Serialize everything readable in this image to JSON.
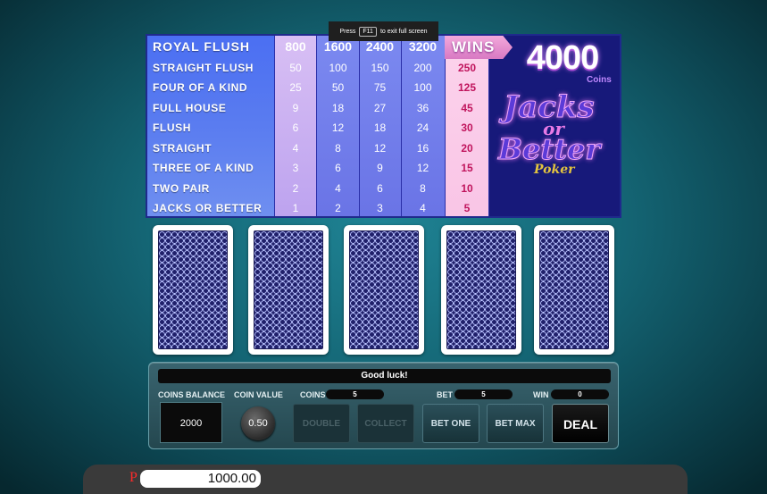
{
  "hint": {
    "prefix": "Press",
    "key": "F11",
    "suffix": "to exit full screen"
  },
  "paytable": {
    "bets": [
      "800",
      "1600",
      "2400",
      "3200"
    ],
    "rows": [
      {
        "name": "ROYAL FLUSH",
        "v": [
          "800",
          "1600",
          "2400",
          "3200"
        ],
        "win": ""
      },
      {
        "name": "STRAIGHT FLUSH",
        "v": [
          "50",
          "100",
          "150",
          "200"
        ],
        "win": "250"
      },
      {
        "name": "FOUR OF A KIND",
        "v": [
          "25",
          "50",
          "75",
          "100"
        ],
        "win": "125"
      },
      {
        "name": "FULL HOUSE",
        "v": [
          "9",
          "18",
          "27",
          "36"
        ],
        "win": "45"
      },
      {
        "name": "FLUSH",
        "v": [
          "6",
          "12",
          "18",
          "24"
        ],
        "win": "30"
      },
      {
        "name": "STRAIGHT",
        "v": [
          "4",
          "8",
          "12",
          "16"
        ],
        "win": "20"
      },
      {
        "name": "THREE OF A KIND",
        "v": [
          "3",
          "6",
          "9",
          "12"
        ],
        "win": "15"
      },
      {
        "name": "TWO PAIR",
        "v": [
          "2",
          "4",
          "6",
          "8"
        ],
        "win": "10"
      },
      {
        "name": "JACKS OR BETTER",
        "v": [
          "1",
          "2",
          "3",
          "4"
        ],
        "win": "5"
      }
    ],
    "wins_label": "WINS",
    "wins_amount": "4000",
    "coins_label": "Coins"
  },
  "logo": {
    "line1": "Jacks",
    "line2": "or",
    "line3": "Better",
    "line4": "Poker"
  },
  "cards": [
    "card-back",
    "card-back",
    "card-back",
    "card-back",
    "card-back"
  ],
  "panel": {
    "message": "Good luck!",
    "coins_balance_label": "COINS BALANCE",
    "coins_balance": "2000",
    "coin_value_label": "COIN VALUE",
    "coin_value": "0.50",
    "coins_label": "COINS",
    "coins": "5",
    "bet_label": "BET",
    "bet": "5",
    "win_label": "WIN",
    "win": "0",
    "btn_double": "DOUBLE",
    "btn_collect": "COLLECT",
    "btn_bet_one": "BET ONE",
    "btn_bet_max": "BET MAX",
    "btn_deal": "DEAL"
  },
  "bottom": {
    "currency_symbol": "P",
    "balance": "1000.00"
  },
  "colors": {
    "accent": "#1f8394",
    "win_column": "#c0145c",
    "paytable_bg": "#2a2fa8"
  }
}
